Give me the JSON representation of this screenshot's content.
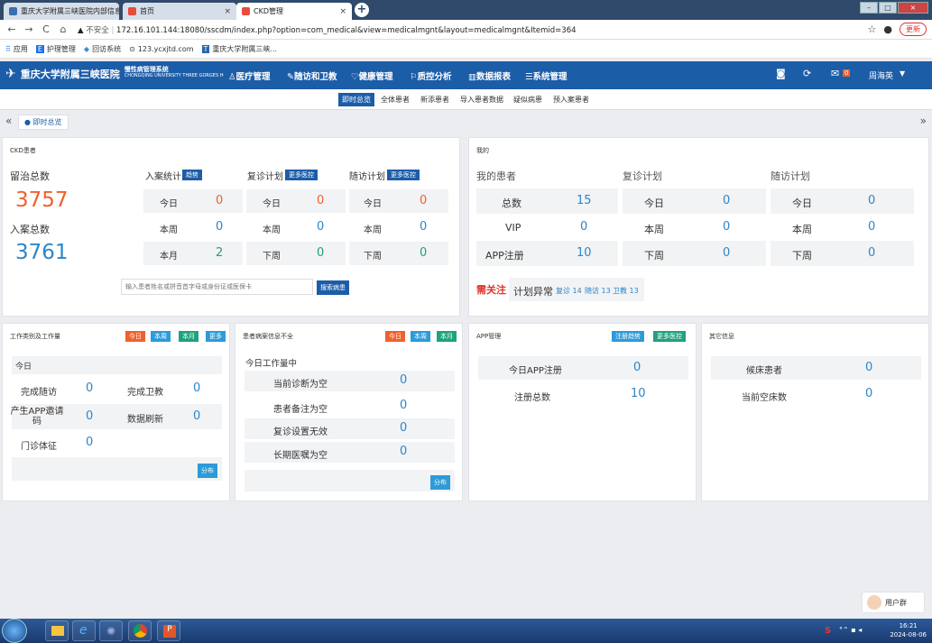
{
  "browser": {
    "tabs": [
      {
        "title": "重庆大学附属三峡医院内部信息",
        "active": false
      },
      {
        "title": "首页",
        "active": false
      },
      {
        "title": "CKD管理",
        "active": true
      }
    ],
    "url_warning": "不安全",
    "url": "172.16.101.144:18080/sscdm/index.php?option=com_medical&view=medicalmgnt&layout=medicalmgnt&Itemid=364",
    "update_label": "更新",
    "bookmarks": [
      "应用",
      "护理管理",
      "回访系统",
      "123.ycxjtd.com",
      "重庆大学附属三峡..."
    ]
  },
  "header": {
    "logo_title": "重庆大学附属三峡医院",
    "logo_sub_cn": "慢性病管理系统",
    "logo_sub_en": "CHONGQING UNIVERSITY THREE GORGES HOSPITAL  Chronic Disease Management",
    "menu": [
      "医疗管理",
      "随访和卫教",
      "健康管理",
      "质控分析",
      "数据报表",
      "系统管理"
    ],
    "mail_count": "0",
    "user": "周海英"
  },
  "subnav": [
    "即时总览",
    "全体患者",
    "新添患者",
    "导入患者数据",
    "疑似病患",
    "预入案患者"
  ],
  "breadcrumb": "即时总览",
  "ckd": {
    "title": "CKD患者",
    "retained_label": "留治总数",
    "retained_value": "3757",
    "enrolled_label": "入案总数",
    "enrolled_value": "3761",
    "stats_title": "入案统计",
    "stats_btn": "趋势",
    "revisit_title": "复诊计划",
    "revisit_btn": "更多医控",
    "followup_title": "随访计划",
    "followup_btn": "更多医控",
    "rows": [
      {
        "a_label": "今日",
        "a_val": "0",
        "b_label": "今日",
        "b_val": "0",
        "c_label": "今日",
        "c_val": "0"
      },
      {
        "a_label": "本周",
        "a_val": "0",
        "b_label": "本周",
        "b_val": "0",
        "c_label": "本周",
        "c_val": "0"
      },
      {
        "a_label": "本月",
        "a_val": "2",
        "b_label": "下周",
        "b_val": "0",
        "c_label": "下周",
        "c_val": "0"
      }
    ],
    "search_placeholder": "输入患者姓名或拼音首字母或身份证或医保卡",
    "search_btn": "搜索病患"
  },
  "mine": {
    "title": "我的",
    "col1": "我的患者",
    "col2": "复诊计划",
    "col3": "随访计划",
    "rows": [
      {
        "a_label": "总数",
        "a_val": "15",
        "b_label": "今日",
        "b_val": "0",
        "c_label": "今日",
        "c_val": "0"
      },
      {
        "a_label": "VIP",
        "a_val": "0",
        "b_label": "本周",
        "b_val": "0",
        "c_label": "本周",
        "c_val": "0"
      },
      {
        "a_label": "APP注册",
        "a_val": "10",
        "b_label": "下周",
        "b_val": "0",
        "c_label": "下周",
        "c_val": "0"
      }
    ],
    "attention_label": "需关注",
    "abnormal_label": "计划异常",
    "abn_revisit": "复诊 14",
    "abn_follow": "随访 13",
    "abn_edu": "卫教 13"
  },
  "work": {
    "title": "工作类别及工作量",
    "btns": [
      "今日",
      "本周",
      "本月",
      "更多"
    ],
    "section": "今日",
    "items": [
      {
        "l1": "完成随访",
        "v1": "0",
        "l2": "完成卫教",
        "v2": "0"
      },
      {
        "l1": "产生APP邀请码",
        "v1": "0",
        "l2": "数据刷新",
        "v2": "0"
      },
      {
        "l1": "门诊体征",
        "v1": "0",
        "l2": "",
        "v2": ""
      }
    ],
    "dist_btn": "分布"
  },
  "incomplete": {
    "title": "患者病案信息不全",
    "btns": [
      "今日",
      "本周",
      "本月"
    ],
    "section": "今日工作量中",
    "items": [
      {
        "label": "当前诊断为空",
        "val": "0"
      },
      {
        "label": "患者备注为空",
        "val": "0"
      },
      {
        "label": "复诊设置无效",
        "val": "0"
      },
      {
        "label": "长期医嘱为空",
        "val": "0"
      }
    ],
    "dist_btn": "分布"
  },
  "app": {
    "title": "APP管理",
    "btns": [
      "注册趋势",
      "更多医控"
    ],
    "items": [
      {
        "label": "今日APP注册",
        "val": "0"
      },
      {
        "label": "注册总数",
        "val": "10"
      }
    ]
  },
  "other": {
    "title": "其它信息",
    "items": [
      {
        "label": "候床患者",
        "val": "0"
      },
      {
        "label": "当前空床数",
        "val": "0"
      }
    ]
  },
  "float_widget": "用户群",
  "clock": {
    "time": "16:21",
    "date": "2024-08-06"
  }
}
